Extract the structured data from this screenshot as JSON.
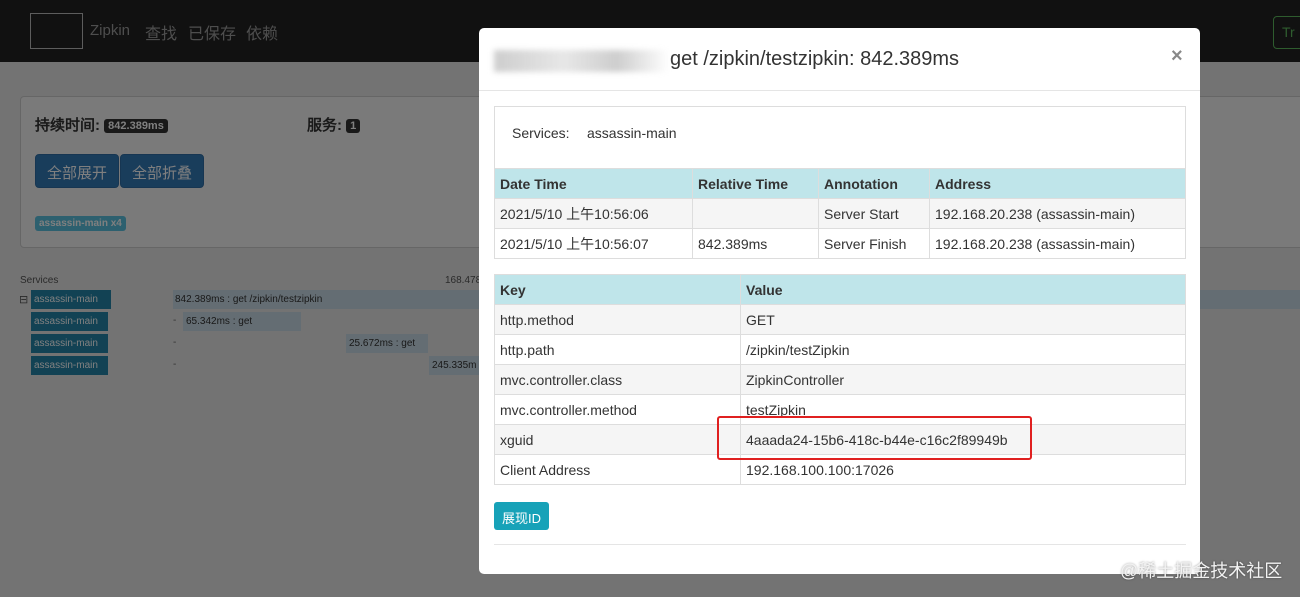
{
  "navbar": {
    "brand": "Zipkin",
    "items": [
      "查找",
      "已保存",
      "依赖"
    ],
    "right_button": "Tr"
  },
  "trace": {
    "duration_label": "持续时间:",
    "duration_value": "842.389ms",
    "services_label": "服务:",
    "services_count": "1",
    "expand_all": "全部展开",
    "collapse_all": "全部折叠",
    "service_tag": "assassin-main x4",
    "services_header": "Services",
    "tick": "168.478",
    "spans": [
      {
        "service": "assassin-main",
        "label": "842.389ms : get /zipkin/testzipkin"
      },
      {
        "service": "assassin-main",
        "label": "65.342ms : get"
      },
      {
        "service": "assassin-main",
        "label": "25.672ms : get"
      },
      {
        "service": "assassin-main",
        "label": "245.335m"
      }
    ]
  },
  "modal": {
    "title": "get /zipkin/testzipkin: 842.389ms",
    "services_label": "Services:",
    "services_value": "assassin-main",
    "annotations": {
      "headers": [
        "Date Time",
        "Relative Time",
        "Annotation",
        "Address"
      ],
      "rows": [
        [
          "2021/5/10 上午10:56:06",
          "",
          "Server Start",
          "192.168.20.238 (assassin-main)"
        ],
        [
          "2021/5/10 上午10:56:07",
          "842.389ms",
          "Server Finish",
          "192.168.20.238 (assassin-main)"
        ]
      ]
    },
    "tags": {
      "headers": [
        "Key",
        "Value"
      ],
      "rows": [
        [
          "http.method",
          "GET"
        ],
        [
          "http.path",
          "/zipkin/testZipkin"
        ],
        [
          "mvc.controller.class",
          "ZipkinController"
        ],
        [
          "mvc.controller.method",
          "testZipkin"
        ],
        [
          "xguid",
          "4aaada24-15b6-418c-b44e-c16c2f89949b"
        ],
        [
          "Client Address",
          "192.168.100.100:17026"
        ]
      ]
    },
    "show_id_button": "展现ID"
  },
  "watermark": "@稀土掘金技术社区"
}
